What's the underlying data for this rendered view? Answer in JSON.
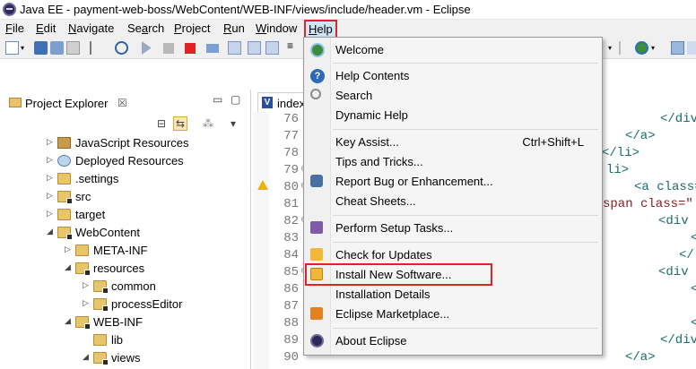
{
  "window": {
    "title": "Java EE - payment-web-boss/WebContent/WEB-INF/views/include/header.vm - Eclipse"
  },
  "menubar": {
    "items": [
      {
        "label": "File",
        "mnemonic": "F"
      },
      {
        "label": "Edit",
        "mnemonic": "E"
      },
      {
        "label": "Navigate",
        "mnemonic": "N"
      },
      {
        "label": "Search",
        "mnemonic": "a"
      },
      {
        "label": "Project",
        "mnemonic": "P"
      },
      {
        "label": "Run",
        "mnemonic": "R"
      },
      {
        "label": "Window",
        "mnemonic": "W"
      },
      {
        "label": "Help",
        "mnemonic": "H"
      }
    ],
    "active": "Help",
    "highlight_color": "#e02424"
  },
  "explorer": {
    "tab_label": "Project Explorer",
    "close_glyph": "☒",
    "tree": [
      {
        "label": "JavaScript Resources",
        "icon": "javascript-resources-icon",
        "twisty": "▷"
      },
      {
        "label": "Deployed Resources",
        "icon": "deployed-resources-icon",
        "twisty": "▷"
      },
      {
        "label": ".settings",
        "icon": "folder-icon",
        "twisty": "▷"
      },
      {
        "label": "src",
        "icon": "folder-icon",
        "twisty": "▷"
      },
      {
        "label": "target",
        "icon": "folder-icon",
        "twisty": "▷"
      },
      {
        "label": "WebContent",
        "icon": "folder-icon",
        "twisty": "◢"
      },
      {
        "label": "META-INF",
        "icon": "folder-icon",
        "twisty": "▷"
      },
      {
        "label": "resources",
        "icon": "folder-icon",
        "twisty": "◢"
      },
      {
        "label": "common",
        "icon": "folder-icon",
        "twisty": "▷"
      },
      {
        "label": "processEditor",
        "icon": "folder-icon",
        "twisty": "▷"
      },
      {
        "label": "WEB-INF",
        "icon": "folder-icon",
        "twisty": "◢"
      },
      {
        "label": "lib",
        "icon": "folder-icon",
        "twisty": ""
      },
      {
        "label": "views",
        "icon": "folder-icon",
        "twisty": "◢"
      }
    ]
  },
  "editor": {
    "tab_label": "index",
    "line_numbers": [
      "76",
      "77",
      "78",
      "79",
      "80",
      "81",
      "82",
      "83",
      "84",
      "85",
      "86",
      "87",
      "88",
      "89",
      "90"
    ],
    "code_lines": [
      {
        "text": "</div",
        "indent": "deep"
      },
      {
        "text": "</a>",
        "indent": "mid"
      },
      {
        "text": "</li>",
        "indent": "low"
      },
      {
        "text": "li>",
        "indent": "lowest"
      },
      {
        "text": "<a class=",
        "indent": "mid"
      },
      {
        "text": "span class=\"",
        "indent": "start",
        "style": "red"
      },
      {
        "text": "<div",
        "indent": "high"
      },
      {
        "text": "<",
        "indent": "deepest"
      },
      {
        "text": "</",
        "indent": "deep"
      },
      {
        "text": "<div",
        "indent": "high"
      },
      {
        "text": "<",
        "indent": "deepest"
      },
      {
        "text": "<",
        "indent": "deepest"
      },
      {
        "text": "</div",
        "indent": "deep"
      },
      {
        "text": "</a>",
        "indent": "mid"
      },
      {
        "text": "</li>",
        "indent": "low"
      }
    ]
  },
  "help_menu": {
    "items": [
      {
        "label": "Welcome",
        "icon": "welcome-icon",
        "shortcut": ""
      },
      {
        "label": "Help Contents",
        "icon": "help-contents-icon",
        "shortcut": ""
      },
      {
        "label": "Search",
        "icon": "search-help-icon",
        "shortcut": ""
      },
      {
        "label": "Dynamic Help",
        "icon": "",
        "shortcut": ""
      },
      {
        "label": "Key Assist...",
        "icon": "",
        "shortcut": "Ctrl+Shift+L"
      },
      {
        "label": "Tips and Tricks...",
        "icon": "",
        "shortcut": ""
      },
      {
        "label": "Report Bug or Enhancement...",
        "icon": "bug-report-icon",
        "shortcut": ""
      },
      {
        "label": "Cheat Sheets...",
        "icon": "",
        "shortcut": ""
      },
      {
        "label": "Perform Setup Tasks...",
        "icon": "setup-tasks-icon",
        "shortcut": ""
      },
      {
        "label": "Check for Updates",
        "icon": "check-updates-icon",
        "shortcut": ""
      },
      {
        "label": "Install New Software...",
        "icon": "install-software-icon",
        "shortcut": "",
        "highlighted": true
      },
      {
        "label": "Installation Details",
        "icon": "",
        "shortcut": ""
      },
      {
        "label": "Eclipse Marketplace...",
        "icon": "marketplace-icon",
        "shortcut": ""
      },
      {
        "label": "About Eclipse",
        "icon": "about-eclipse-icon",
        "shortcut": ""
      }
    ]
  }
}
